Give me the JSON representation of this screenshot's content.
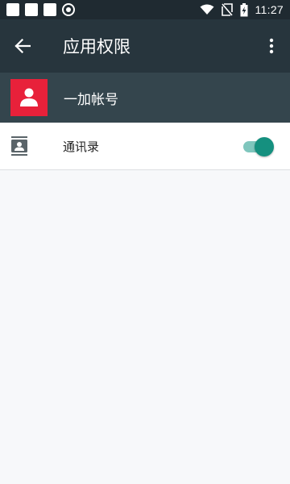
{
  "status_bar": {
    "time": "11:27",
    "icons": [
      "notification-square-icon",
      "notification-square-icon",
      "notification-square-icon",
      "shield-icon",
      "wifi-icon",
      "no-sim-icon",
      "battery-charging-icon"
    ]
  },
  "app_bar": {
    "title": "应用权限",
    "back_icon": "arrow-back-icon",
    "menu_icon": "more-vert-icon"
  },
  "account": {
    "label": "一加帐号",
    "avatar_color": "#e8213a"
  },
  "permissions": [
    {
      "label": "通讯录",
      "icon": "contacts-icon",
      "enabled": true
    }
  ],
  "colors": {
    "status_bar": "#1f2a31",
    "app_bar": "#27353d",
    "account_bar": "#34454d",
    "toggle_on": "#15907f",
    "toggle_track": "#7fc6bd"
  }
}
